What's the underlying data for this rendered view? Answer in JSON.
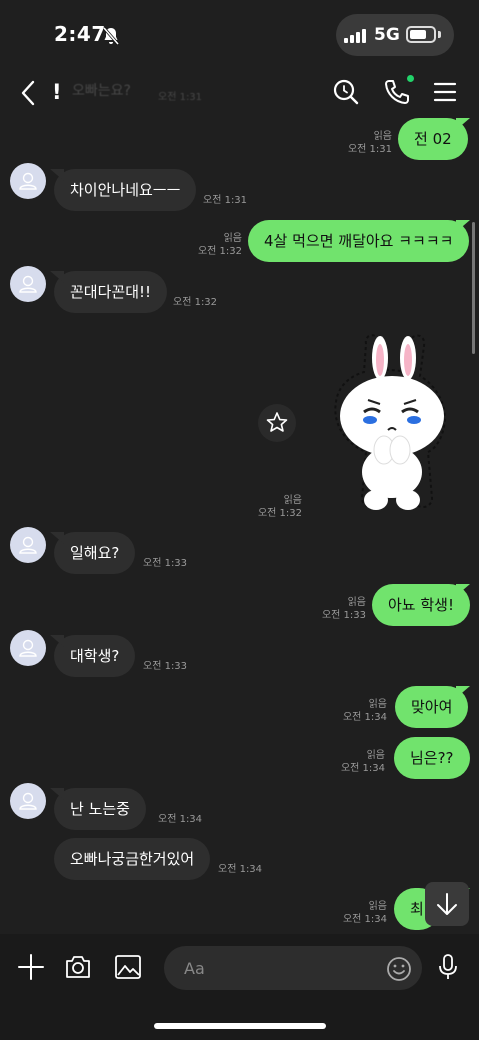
{
  "status_bar": {
    "time": "2:47",
    "network": "5G"
  },
  "header": {
    "title": "!",
    "ghost_title": "오빠는요?",
    "ghost_time": "오전 1:31"
  },
  "messages": [
    {
      "side": "out",
      "text": "전 02",
      "read": "읽음",
      "time": "오전 1:31"
    },
    {
      "side": "in",
      "text": "차이안나네요ㅡㅡ",
      "time": "오전 1:31"
    },
    {
      "side": "out",
      "text": "4살 먹으면 깨달아요 ㅋㅋㅋㅋ",
      "read": "읽음",
      "time": "오전 1:32"
    },
    {
      "side": "in",
      "text": "꼰대다꼰대!!",
      "time": "오전 1:32"
    },
    {
      "side": "out",
      "type": "sticker",
      "sticker": "crying-bunny-sticker",
      "read": "읽음",
      "time": "오전 1:32"
    },
    {
      "side": "in",
      "text": "일해요?",
      "time": "오전 1:33"
    },
    {
      "side": "out",
      "text": "아뇨 학생!",
      "read": "읽음",
      "time": "오전 1:33"
    },
    {
      "side": "in",
      "text": "대학생?",
      "time": "오전 1:33"
    },
    {
      "side": "out",
      "text": "맞아여",
      "read": "읽음",
      "time": "오전 1:34"
    },
    {
      "side": "out",
      "text": "님은??",
      "read": "읽음",
      "time": "오전 1:34"
    },
    {
      "side": "in",
      "text": "난 노는중",
      "time": "오전 1:34"
    },
    {
      "side": "in",
      "text": "오빠나궁금한거있어",
      "time": "오전 1:34"
    },
    {
      "side": "out",
      "text": "최",
      "read": "읽음",
      "time": "오전 1:34"
    }
  ],
  "input": {
    "placeholder": "Aa"
  },
  "icons": {
    "back": "chevron-left-icon",
    "search": "search-icon",
    "call": "phone-icon",
    "menu": "hamburger-menu-icon",
    "add": "plus-icon",
    "camera": "camera-icon",
    "gallery": "image-icon",
    "emoji": "emoji-icon",
    "voice": "microphone-icon",
    "scroll_down": "arrow-down-icon",
    "favorite": "star-icon"
  },
  "colors": {
    "background": "#1f1f1f",
    "outgoing_bubble": "#71e36d",
    "incoming_bubble": "#2e2e2e",
    "online_dot": "#22d36a"
  }
}
